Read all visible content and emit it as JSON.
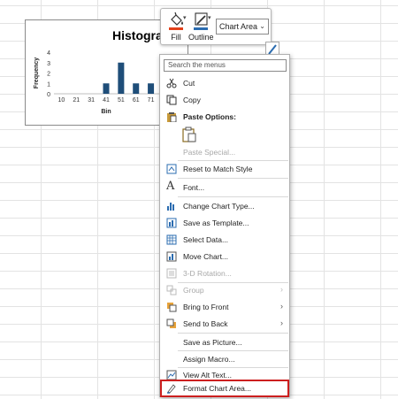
{
  "chart": {
    "title": "Histogram",
    "chart_data": {
      "type": "bar",
      "title": "Histogram",
      "xlabel": "Bin",
      "ylabel": "Frequency",
      "categories": [
        "10",
        "21",
        "31",
        "41",
        "51",
        "61",
        "71"
      ],
      "values": [
        0,
        0,
        0,
        1,
        3,
        1,
        1
      ],
      "ylim": [
        0,
        4
      ],
      "yticks": [
        "0",
        "1",
        "2",
        "3",
        "4"
      ],
      "bar_color": "#1f4e79"
    }
  },
  "minitoolbar": {
    "fill_label": "Fill",
    "outline_label": "Outline",
    "element_value": "Chart Area",
    "fill_color": "#e2401a",
    "outline_color": "#2b6cb0"
  },
  "menu": {
    "search_placeholder": "Search the menus",
    "items": [
      {
        "label": "Cut",
        "icon": "scissors-icon",
        "disabled": false,
        "submenu": false
      },
      {
        "label": "Copy",
        "icon": "copy-icon",
        "disabled": false,
        "submenu": false
      },
      {
        "label": "Paste Options:",
        "icon": "paste-icon",
        "disabled": false,
        "submenu": false
      },
      {
        "label": "Paste Special...",
        "icon": "",
        "disabled": true,
        "submenu": false
      },
      {
        "label": "Reset to Match Style",
        "icon": "reset-style-icon",
        "disabled": false,
        "submenu": false
      },
      {
        "label": "Font...",
        "icon": "font-icon",
        "disabled": false,
        "submenu": false
      },
      {
        "label": "Change Chart Type...",
        "icon": "chart-type-icon",
        "disabled": false,
        "submenu": false
      },
      {
        "label": "Save as Template...",
        "icon": "template-icon",
        "disabled": false,
        "submenu": false
      },
      {
        "label": "Select Data...",
        "icon": "select-data-icon",
        "disabled": false,
        "submenu": false
      },
      {
        "label": "Move Chart...",
        "icon": "move-chart-icon",
        "disabled": false,
        "submenu": false
      },
      {
        "label": "3-D Rotation...",
        "icon": "rotation-icon",
        "disabled": true,
        "submenu": false
      },
      {
        "label": "Group",
        "icon": "group-icon",
        "disabled": true,
        "submenu": true
      },
      {
        "label": "Bring to Front",
        "icon": "bring-front-icon",
        "disabled": false,
        "submenu": true
      },
      {
        "label": "Send to Back",
        "icon": "send-back-icon",
        "disabled": false,
        "submenu": true
      },
      {
        "label": "Save as Picture...",
        "icon": "",
        "disabled": false,
        "submenu": false
      },
      {
        "label": "Assign Macro...",
        "icon": "",
        "disabled": false,
        "submenu": false
      },
      {
        "label": "View Alt Text...",
        "icon": "alt-text-icon",
        "disabled": false,
        "submenu": false
      },
      {
        "label": "Format Chart Area...",
        "icon": "format-chart-area-icon",
        "disabled": false,
        "submenu": false,
        "highlighted": true
      }
    ]
  }
}
